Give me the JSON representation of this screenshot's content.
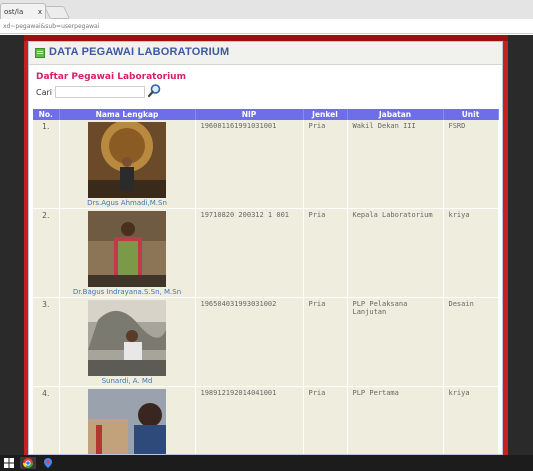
{
  "browser": {
    "tab_title": "ost/la",
    "tab_close": "x",
    "url": "xd~pegawai&sub=userpegawai"
  },
  "header": {
    "title": "DATA PEGAWAI LABORATORIUM"
  },
  "subheader": "Daftar Pegawai Laboratorium",
  "search": {
    "label": "Cari",
    "value": ""
  },
  "table": {
    "columns": [
      "No.",
      "Nama Lengkap",
      "NIP",
      "Jenkel",
      "Jabatan",
      "Unit"
    ],
    "rows": [
      {
        "no": "1.",
        "nama": "Drs.Agus Ahmadi,M.Sn",
        "nip": "196001161991031001",
        "jenkel": "Pria",
        "jabatan": "Wakil Dekan III",
        "unit": "FSRD"
      },
      {
        "no": "2.",
        "nama": "Dr.Bagus Indrayana.S.Sn, M.Sn",
        "nip": "19710820 200312 1 001",
        "jenkel": "Pria",
        "jabatan": "Kepala Laboratorium",
        "unit": "kriya"
      },
      {
        "no": "3.",
        "nama": "Sunardi, A. Md",
        "nip": "196504031993031002",
        "jenkel": "Pria",
        "jabatan": "PLP Pelaksana Lanjutan",
        "unit": "Desain"
      },
      {
        "no": "4.",
        "nama": "",
        "nip": "198912192014041001",
        "jenkel": "Pria",
        "jabatan": "PLP Pertama",
        "unit": "kriya"
      }
    ]
  },
  "colors": {
    "header_bg": "#6d6ee8",
    "row_bg": "#eeedde",
    "title_blue": "#3c5aa0",
    "subtitle_pink": "#d8206a",
    "page_red": "#c81f1f"
  },
  "icons": {
    "search": "magnifier-icon",
    "header": "green-square-icon"
  }
}
